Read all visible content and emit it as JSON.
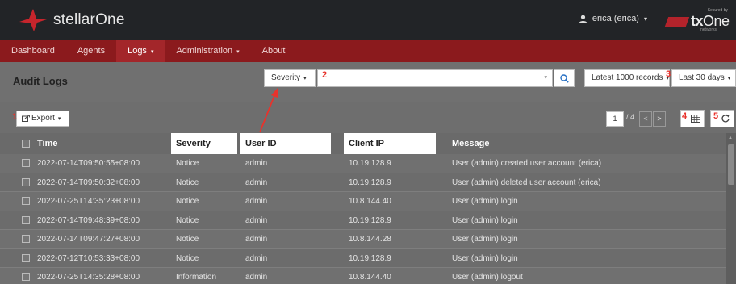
{
  "app": {
    "brand": "stellarOne"
  },
  "user": {
    "name": "erica (erica)"
  },
  "vendor": {
    "secured_by": "Secured by",
    "logo_tx": "tx",
    "logo_one": "One",
    "networks": "networks"
  },
  "nav": [
    {
      "label": "Dashboard",
      "caret": ""
    },
    {
      "label": "Agents",
      "caret": ""
    },
    {
      "label": "Logs",
      "caret": "▾"
    },
    {
      "label": "Administration",
      "caret": "▾"
    },
    {
      "label": "About",
      "caret": ""
    }
  ],
  "page": {
    "title": "Audit Logs"
  },
  "filters": {
    "severity_label": "Severity",
    "search_value": "",
    "records_label": "Latest 1000 records",
    "range_label": "Last 30 days"
  },
  "toolbar": {
    "export_label": "Export"
  },
  "pagination": {
    "current": "1",
    "total": "/ 4",
    "prev": "<",
    "next": ">"
  },
  "markers": [
    "1",
    "2",
    "3",
    "4",
    "5"
  ],
  "table": {
    "columns": [
      "Time",
      "Severity",
      "User ID",
      "Client IP",
      "Message"
    ],
    "rows": [
      [
        "2022-07-14T09:50:55+08:00",
        "Notice",
        "admin",
        "10.19.128.9",
        "User (admin) created user account (erica)"
      ],
      [
        "2022-07-14T09:50:32+08:00",
        "Notice",
        "admin",
        "10.19.128.9",
        "User (admin) deleted user account (erica)"
      ],
      [
        "2022-07-25T14:35:23+08:00",
        "Notice",
        "admin",
        "10.8.144.40",
        "User (admin) login"
      ],
      [
        "2022-07-14T09:48:39+08:00",
        "Notice",
        "admin",
        "10.19.128.9",
        "User (admin) login"
      ],
      [
        "2022-07-14T09:47:27+08:00",
        "Notice",
        "admin",
        "10.8.144.28",
        "User (admin) login"
      ],
      [
        "2022-07-12T10:53:33+08:00",
        "Notice",
        "admin",
        "10.19.128.9",
        "User (admin) login"
      ],
      [
        "2022-07-25T14:35:28+08:00",
        "Information",
        "admin",
        "10.8.144.40",
        "User (admin) logout"
      ]
    ]
  },
  "colors": {
    "topbar": "#222427",
    "navbar": "#8b1a1d",
    "accent_red": "#e8332c"
  }
}
